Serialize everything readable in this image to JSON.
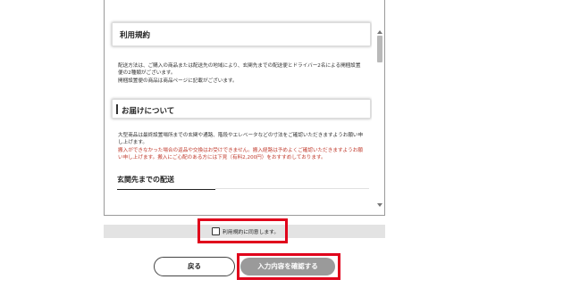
{
  "terms": {
    "title": "利用規約",
    "para1_line1": "配送方法は、ご購入の商品または配送先の地域により、玄関先までの配送便とドライバー2名による開梱設置",
    "para1_line2": "便の2種類がございます。",
    "para1_line3": "開梱設置便の商品は商品ページに記載がございます。",
    "delivery_heading": "お届けについて",
    "para2_line1": "大型商品は最終設置場所までの玄関や通路、階段やエレベータなどの寸法をご確認いただきますようお願い申",
    "para2_line2": "し上げます。",
    "para2_red_line1": "搬入ができなかった場合の返品や交換はお受けできません。搬入経路は予めよくご確認いただきますようお願",
    "para2_red_line2": "い申し上げます。搬入にご心配のある方には下見（有料2,200円）をおすすめしております。",
    "entrance_heading": "玄関先までの配送"
  },
  "agreement": {
    "checkbox_label": "利用規約に同意します。",
    "checked": false
  },
  "buttons": {
    "back_label": "戻る",
    "confirm_label": "入力内容を確認する"
  },
  "colors": {
    "highlight": "#e0001b",
    "confirm_button": "#9a9a9a",
    "warning_text": "#c0392b"
  }
}
